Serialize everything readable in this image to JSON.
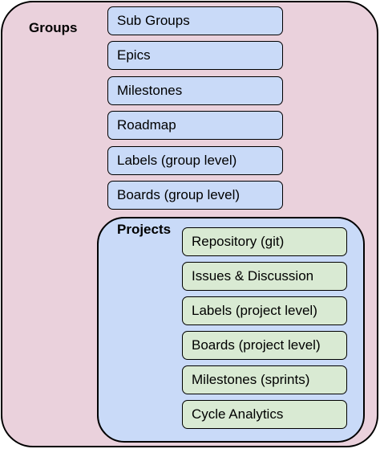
{
  "groups": {
    "title": "Groups",
    "items": [
      {
        "label": "Sub Groups"
      },
      {
        "label": "Epics"
      },
      {
        "label": "Milestones"
      },
      {
        "label": "Roadmap"
      },
      {
        "label": "Labels (group level)"
      },
      {
        "label": "Boards (group level)"
      }
    ],
    "color": "#ead1dc",
    "item_color": "#c9daf8"
  },
  "projects": {
    "title": "Projects",
    "items": [
      {
        "label": "Repository (git)"
      },
      {
        "label": "Issues & Discussion"
      },
      {
        "label": "Labels (project level)"
      },
      {
        "label": "Boards (project level)"
      },
      {
        "label": "Milestones (sprints)"
      },
      {
        "label": "Cycle Analytics"
      }
    ],
    "color": "#c9daf8",
    "item_color": "#d9ead3"
  }
}
